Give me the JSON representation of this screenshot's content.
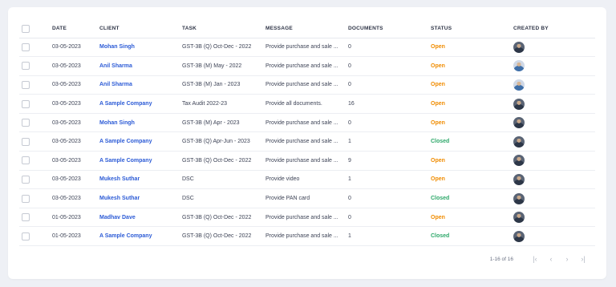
{
  "table": {
    "headers": {
      "date": "DATE",
      "client": "CLIENT",
      "task": "TASK",
      "message": "MESSAGE",
      "documents": "DOCUMENTS",
      "status": "STATUS",
      "created_by": "CREATED BY"
    },
    "rows": [
      {
        "date": "03-05-2023",
        "client": "Mohan Singh",
        "task": "GST-3B (Q) Oct-Dec - 2022",
        "message": "Provide purchase and sale ...",
        "documents": "0",
        "status": "Open",
        "avatar": "avatar-icon"
      },
      {
        "date": "03-05-2023",
        "client": "Anil Sharma",
        "task": "GST-3B (M) May - 2022",
        "message": "Provide purchase and sale ...",
        "documents": "0",
        "status": "Open",
        "avatar": "avatar-icon"
      },
      {
        "date": "03-05-2023",
        "client": "Anil Sharma",
        "task": "GST-3B (M) Jan - 2023",
        "message": "Provide purchase and sale ...",
        "documents": "0",
        "status": "Open",
        "avatar": "avatar-icon"
      },
      {
        "date": "03-05-2023",
        "client": "A Sample Company",
        "task": "Tax Audit 2022-23",
        "message": "Provide all documents.",
        "documents": "16",
        "status": "Open",
        "avatar": "avatar-icon"
      },
      {
        "date": "03-05-2023",
        "client": "Mohan Singh",
        "task": "GST-3B (M) Apr - 2023",
        "message": "Provide purchase and sale ...",
        "documents": "0",
        "status": "Open",
        "avatar": "avatar-icon"
      },
      {
        "date": "03-05-2023",
        "client": "A Sample Company",
        "task": "GST-3B (Q) Apr-Jun - 2023",
        "message": "Provide purchase and sale ...",
        "documents": "1",
        "status": "Closed",
        "avatar": "avatar-icon"
      },
      {
        "date": "03-05-2023",
        "client": "A Sample Company",
        "task": "GST-3B (Q) Oct-Dec - 2022",
        "message": "Provide purchase and sale ...",
        "documents": "9",
        "status": "Open",
        "avatar": "avatar-icon"
      },
      {
        "date": "03-05-2023",
        "client": "Mukesh Suthar",
        "task": "DSC",
        "message": "Provide video",
        "documents": "1",
        "status": "Open",
        "avatar": "avatar-icon"
      },
      {
        "date": "03-05-2023",
        "client": "Mukesh Suthar",
        "task": "DSC",
        "message": "Provide PAN card",
        "documents": "0",
        "status": "Closed",
        "avatar": "avatar-icon"
      },
      {
        "date": "01-05-2023",
        "client": "Madhav Dave",
        "task": "GST-3B (Q) Oct-Dec - 2022",
        "message": "Provide purchase and sale ...",
        "documents": "0",
        "status": "Open",
        "avatar": "avatar-icon"
      },
      {
        "date": "01-05-2023",
        "client": "A Sample Company",
        "task": "GST-3B (Q) Oct-Dec - 2022",
        "message": "Provide purchase and sale ...",
        "documents": "1",
        "status": "Closed",
        "avatar": "avatar-icon"
      }
    ]
  },
  "colors": {
    "open": "#f08c00",
    "closed": "#2ea86a",
    "client_link": "#2c5bd6"
  },
  "pagination": {
    "range": "1-16 of 16",
    "first_icon": "first-page-icon",
    "prev_icon": "prev-page-icon",
    "next_icon": "next-page-icon",
    "last_icon": "last-page-icon"
  }
}
